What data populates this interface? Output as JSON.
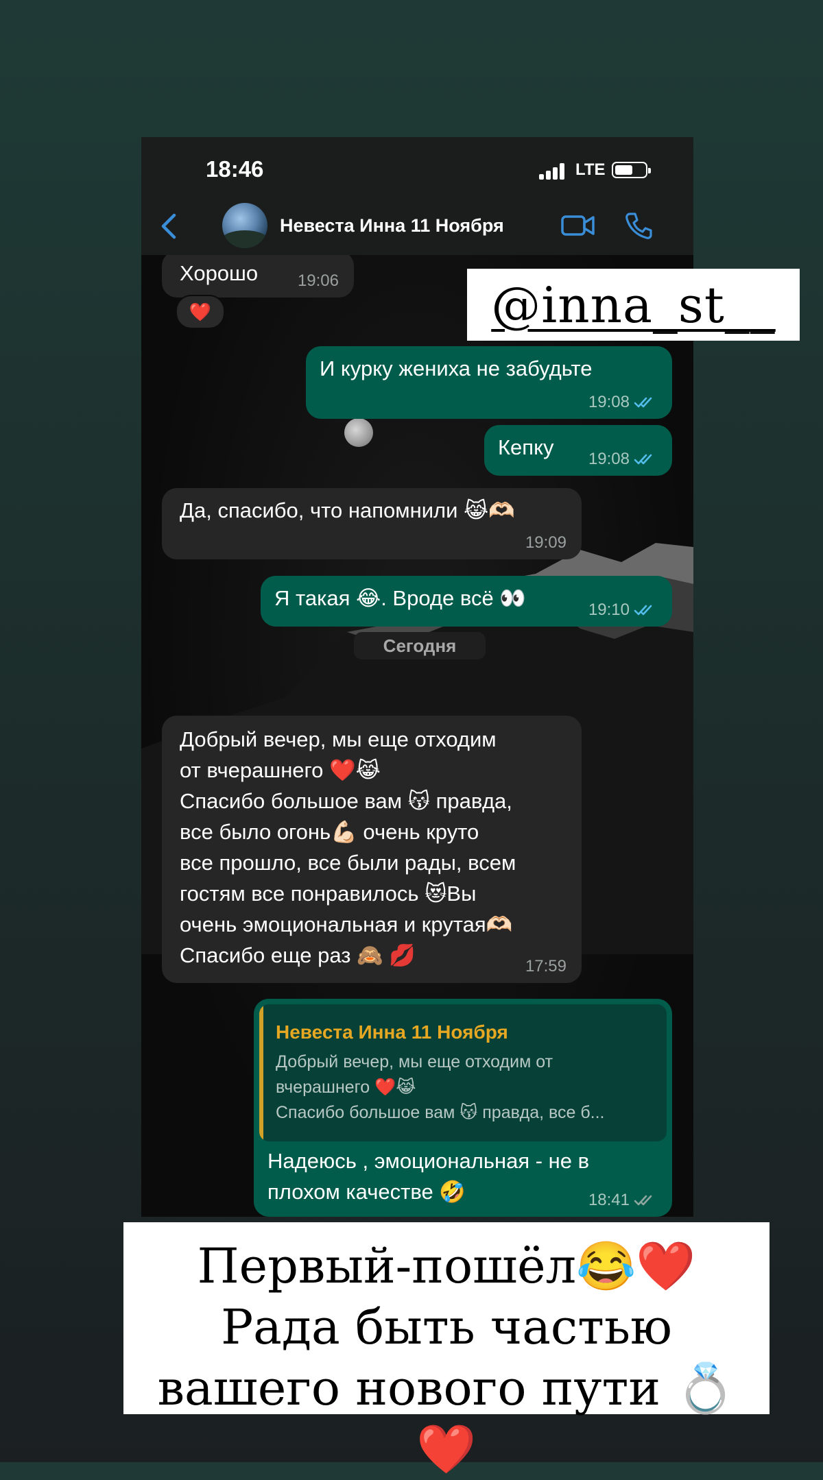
{
  "status_bar": {
    "time": "18:46",
    "network": "LTE",
    "battery_level": 0.6
  },
  "header": {
    "contact_name": "Невеста Инна 11 Ноября"
  },
  "messages": [
    {
      "direction": "in",
      "text": "Хорошо",
      "time": "19:06",
      "reaction": "❤️"
    },
    {
      "direction": "out",
      "text": "И курку жениха не забудьте",
      "time": "19:08",
      "read": true
    },
    {
      "direction": "out",
      "text": "Кепку",
      "time": "19:08",
      "read": true
    },
    {
      "direction": "in",
      "text": "Да, спасибо, что напомнили 😹🫶🏻",
      "time": "19:09"
    },
    {
      "direction": "out",
      "text": "Я такая 😂. Вроде всё 👀",
      "time": "19:10",
      "read": true
    },
    {
      "direction": "in",
      "text": "Добрый вечер, мы еще отходим\nот вчерашнего ❤️😹\nСпасибо большое вам 😽 правда,\nвсе было огонь💪🏻 очень круто\nвсе прошло, все были рады, всем\nгостям все понравилось 😻Вы\nочень эмоциональная и крутая🫶🏻\nСпасибо еще раз 🙈 💋",
      "time": "17:59"
    },
    {
      "direction": "out",
      "reply_to_name": "Невеста Инна 11 Ноября",
      "reply_to_text": "Добрый вечер, мы еще отходим от\nвчерашнего ❤️😹\nСпасибо большое вам 😽 правда, все б...",
      "text": "Надеюсь , эмоциональная - не в\nплохом качестве 🤣",
      "time": "18:41",
      "read": false
    }
  ],
  "date_divider": "Сегодня",
  "overlay_handle": "@inna_st__",
  "caption": "Первый-пошёл😂❤️ Рада быть частью вашего нового пути 💍❤️",
  "colors": {
    "incoming": "#262626",
    "outgoing": "#015c4b",
    "accent_blue": "#3a8ed8",
    "quote_name": "#e6a822"
  }
}
